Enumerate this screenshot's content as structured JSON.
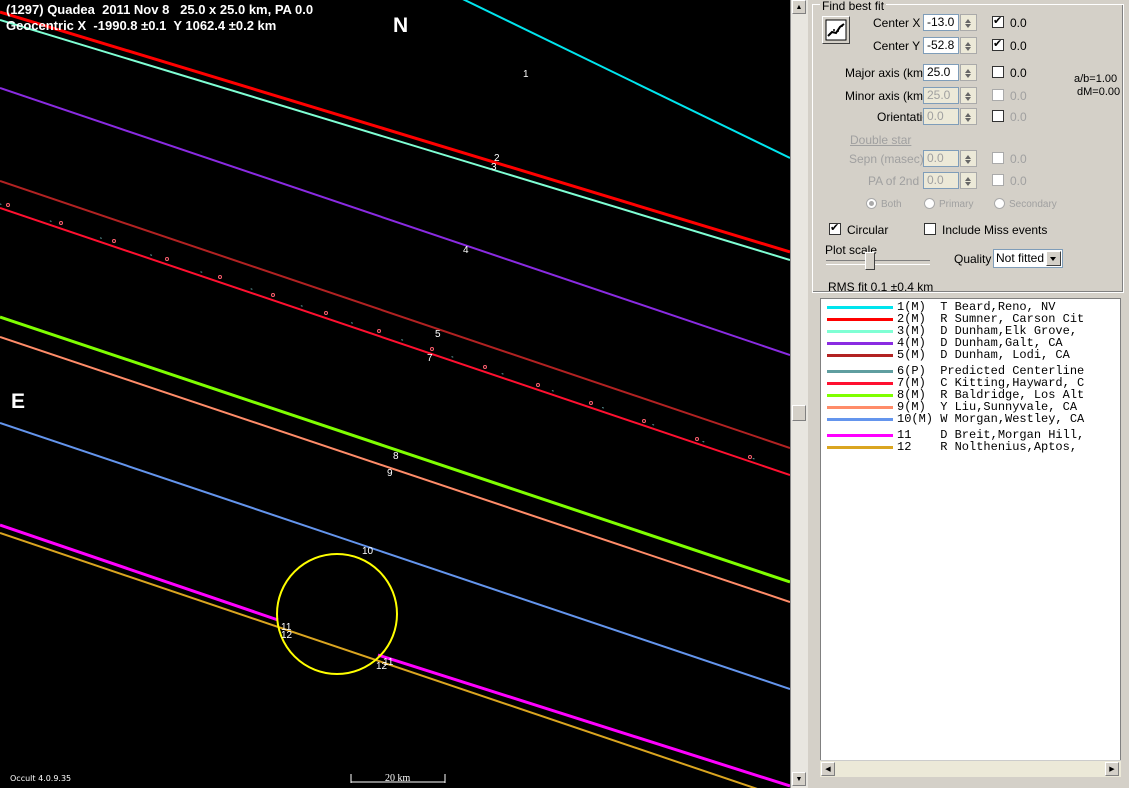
{
  "header": {
    "line1": "(1297) Quadea  2011 Nov 8   25.0 x 25.0 km, PA 0.0",
    "line2": "Geocentric X  -1990.8 ±0.1  Y 1062.4 ±0.2 km"
  },
  "directions": {
    "north": "N",
    "east": "E"
  },
  "version": "Occult 4.0.9.35",
  "scale_bar": "20 km",
  "chords": [
    {
      "n": "1",
      "color": "#00e5ee"
    },
    {
      "n": "2",
      "color": "#ff0000"
    },
    {
      "n": "3",
      "color": "#7fffd4"
    },
    {
      "n": "4",
      "color": "#8a2be2"
    },
    {
      "n": "5",
      "color": "#b22222"
    },
    {
      "n": "7",
      "color": "#ff1030"
    },
    {
      "n": "8",
      "color": "#7fff00"
    },
    {
      "n": "9",
      "color": "#ff8c69"
    },
    {
      "n": "10",
      "color": "#6495ed"
    },
    {
      "n": "11",
      "color": "#ff00ff"
    },
    {
      "n": "12",
      "color": "#daa520"
    }
  ],
  "panel": {
    "group_title": "Find best fit",
    "center_x_label": "Center X",
    "center_x_value": "-13.0",
    "center_x_unc": "0.0",
    "center_x_checked": true,
    "center_y_label": "Center Y",
    "center_y_value": "-52.8",
    "center_y_unc": "0.0",
    "center_y_checked": true,
    "major_label": "Major axis (km)",
    "major_value": "25.0",
    "major_unc": "0.0",
    "minor_label": "Minor axis (km)",
    "minor_value": "25.0",
    "minor_unc": "0.0",
    "orient_label": "Orientation",
    "orient_value": "0.0",
    "orient_unc": "0.0",
    "ab_ratio": "a/b=1.00",
    "dm": "dM=0.00",
    "double_star": "Double star",
    "sepn_label": "Sepn (masec)",
    "sepn_value": "0.0",
    "sepn_unc": "0.0",
    "pa2_label": "PA of 2nd",
    "pa2_value": "0.0",
    "pa2_unc": "0.0",
    "radio_both": "Both",
    "radio_primary": "Primary",
    "radio_secondary": "Secondary",
    "circular_label": "Circular",
    "circular_checked": true,
    "miss_label": "Include Miss events",
    "miss_checked": false,
    "plot_scale_label": "Plot scale",
    "quality_label": "Quality",
    "quality_value": "Not fitted",
    "rms": "RMS fit 0.1 ±0.4 km"
  },
  "legend": [
    {
      "color": "#00e5ee",
      "text": "1(M)  T Beard,Reno, NV"
    },
    {
      "color": "#ff0000",
      "text": "2(M)  R Sumner, Carson Cit"
    },
    {
      "color": "#7fffd4",
      "text": "3(M)  D Dunham,Elk Grove,"
    },
    {
      "color": "#8a2be2",
      "text": "4(M)  D Dunham,Galt, CA"
    },
    {
      "color": "#b22222",
      "text": "5(M)  D Dunham, Lodi, CA"
    },
    {
      "color": "#5f9ea0",
      "text": "6(P)  Predicted Centerline"
    },
    {
      "color": "#ff1030",
      "text": "7(M)  C Kitting,Hayward, C"
    },
    {
      "color": "#7fff00",
      "text": "8(M)  R Baldridge, Los Alt"
    },
    {
      "color": "#ff8c69",
      "text": "9(M)  Y Liu,Sunnyvale, CA"
    },
    {
      "color": "#6495ed",
      "text": "10(M) W Morgan,Westley, CA"
    },
    {
      "color": "#ff00ff",
      "text": "11    D Breit,Morgan Hill,"
    },
    {
      "color": "#daa520",
      "text": "12    R Nolthenius,Aptos,"
    }
  ]
}
